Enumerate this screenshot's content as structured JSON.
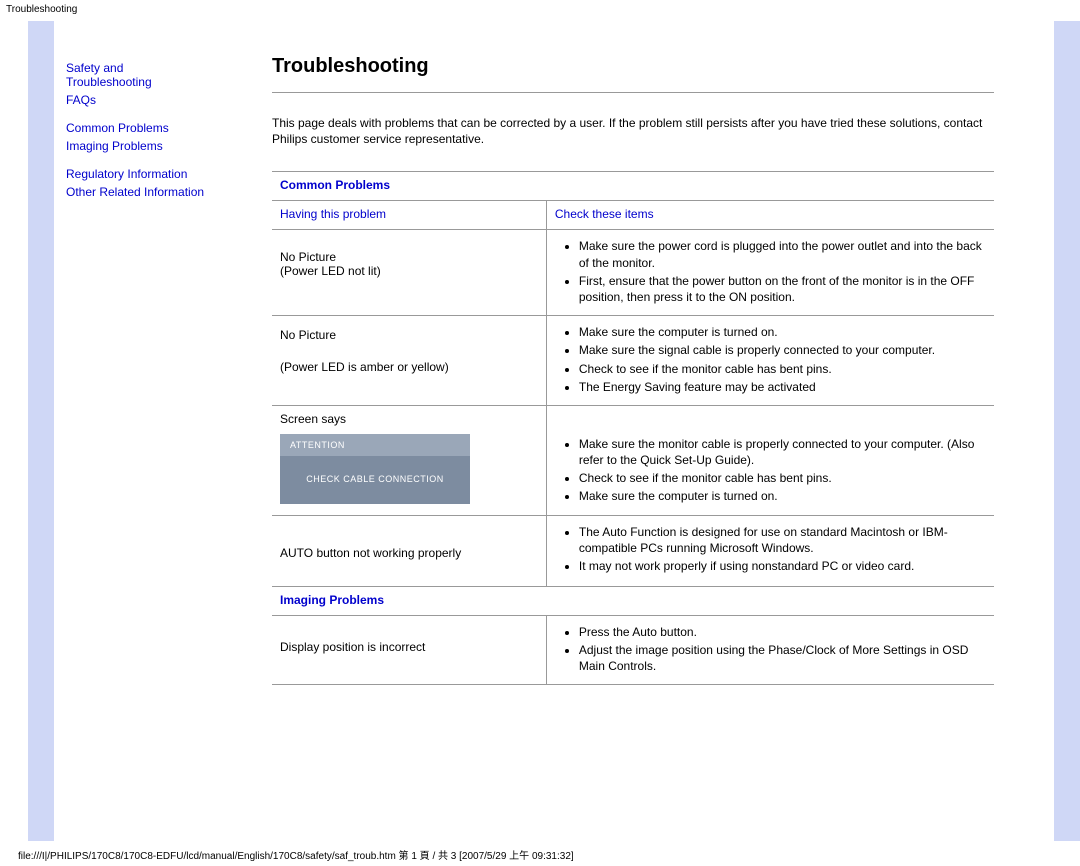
{
  "pageHeader": "Troubleshooting",
  "sidebar": {
    "group1": {
      "link1_line1": "Safety and",
      "link1_line2": "Troubleshooting",
      "link2": "FAQs"
    },
    "group2": {
      "link1": "Common Problems",
      "link2": "Imaging Problems"
    },
    "group3": {
      "link1": "Regulatory Information",
      "link2": "Other Related Information"
    }
  },
  "main": {
    "title": "Troubleshooting",
    "intro": "This page deals with problems that can be corrected by a user. If the problem still persists after you have tried these solutions, contact Philips customer service representative.",
    "sections": {
      "common": {
        "heading": "Common Problems",
        "colLeft": "Having this problem",
        "colRight": "Check these items",
        "rows": [
          {
            "problem_line1": "No Picture",
            "problem_line2": "(Power LED not lit)",
            "checks": [
              "Make sure the power cord is plugged into the power outlet and into the back of the monitor.",
              "First, ensure that the power button on the front of the monitor is in the OFF position, then press it to the ON position."
            ]
          },
          {
            "problem_line1": "No Picture",
            "problem_line2": "(Power LED is amber or yellow)",
            "checks": [
              "Make sure the computer is turned on.",
              "Make sure the signal cable is properly connected to your computer.",
              "Check to see if the monitor cable has bent pins.",
              "The Energy Saving feature may be activated"
            ]
          },
          {
            "problem_line1": "Screen says",
            "screen_bar": "ATTENTION",
            "screen_body": "CHECK CABLE CONNECTION",
            "checks": [
              "Make sure the monitor cable is properly connected to your computer. (Also refer to the Quick Set-Up Guide).",
              "Check to see if the monitor cable has bent pins.",
              "Make sure the computer is turned on."
            ]
          },
          {
            "problem_line1": "AUTO button not working properly",
            "checks": [
              "The Auto Function is designed for use on standard Macintosh or IBM-compatible PCs running Microsoft Windows.",
              "It may not work properly if using nonstandard PC or video card."
            ]
          }
        ]
      },
      "imaging": {
        "heading": "Imaging Problems",
        "rows": [
          {
            "problem_line1": "Display position is incorrect",
            "checks": [
              "Press the Auto button.",
              "Adjust the image position using the Phase/Clock of More Settings in OSD Main Controls."
            ]
          }
        ]
      }
    }
  },
  "footer": "file:///I|/PHILIPS/170C8/170C8-EDFU/lcd/manual/English/170C8/safety/saf_troub.htm 第 1 頁 / 共 3  [2007/5/29 上午 09:31:32]"
}
